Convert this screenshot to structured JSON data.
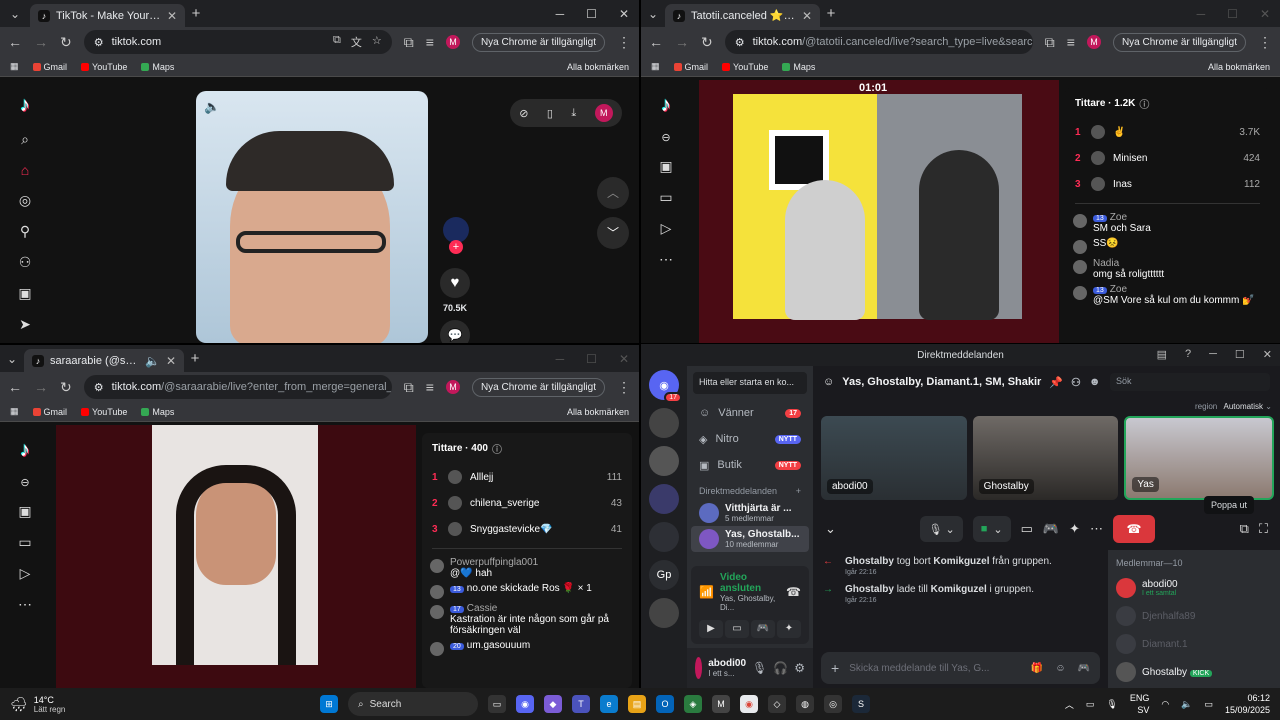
{
  "win1": {
    "tab_title": "TikTok - Make Your Day",
    "url": "tiktok.com",
    "update_label": "Nya Chrome är tillgängligt",
    "bookmarks": [
      "Gmail",
      "YouTube",
      "Maps"
    ],
    "all_bookmarks": "Alla bokmärken",
    "like_count": "70.5K",
    "profile_letter": "M"
  },
  "win2": {
    "tab_title": "Tatotii.canceled ⭐ (@tatotii.ca",
    "url_host": "tiktok.com",
    "url_path": "/@tatotii.canceled/live?search_type=live&search_id=2025...",
    "update_label": "Nya Chrome är tillgängligt",
    "bookmarks": [
      "Gmail",
      "YouTube",
      "Maps"
    ],
    "all_bookmarks": "Alla bokmärken",
    "timer": "01:01",
    "viewers_label": "Tittare · 1.2K",
    "ranking": [
      {
        "rank": "1",
        "name": "✌",
        "score": "3.7K"
      },
      {
        "rank": "2",
        "name": "Minisen",
        "score": "424"
      },
      {
        "rank": "3",
        "name": "Inas",
        "score": "112"
      }
    ],
    "chat": [
      {
        "user": "Zoe",
        "badge": "13",
        "text": "SM och Sara"
      },
      {
        "user": "",
        "badge": "",
        "text": "SS😣"
      },
      {
        "user": "Nadia",
        "badge": "",
        "text": "omg så roligtttttt"
      },
      {
        "user": "Zoe",
        "badge": "13",
        "text": "@SM Vore så kul om du kommm 💅"
      }
    ]
  },
  "win3": {
    "tab_title": "saraarabie (@saraarabie) ä",
    "url_host": "tiktok.com",
    "url_path": "/@saraarabie/live?enter_from_merge=general_search&en...",
    "update_label": "Nya Chrome är tillgängligt",
    "bookmarks": [
      "Gmail",
      "YouTube",
      "Maps"
    ],
    "all_bookmarks": "Alla bokmärken",
    "viewers_label": "Tittare · 400",
    "ranking": [
      {
        "rank": "1",
        "name": "Alllejj",
        "score": "111"
      },
      {
        "rank": "2",
        "name": "chilena_sverige",
        "score": "43"
      },
      {
        "rank": "3",
        "name": "Snyggastevicke💎",
        "score": "41"
      }
    ],
    "chat": [
      {
        "user": "Powerpuffpingla001",
        "badge": "",
        "text": "@💙 hah"
      },
      {
        "user": "",
        "badge": "13",
        "text": "no.one skickade Ros 🌹 × 1"
      },
      {
        "user": "Cassie",
        "badge": "17",
        "text": "Kastration är inte någon som går på försäkringen väl"
      },
      {
        "user": "",
        "badge": "20",
        "text": "um.gasouuum"
      }
    ]
  },
  "discord": {
    "title": "Direktmeddelanden",
    "search_dm": "Hitta eller starta en ko...",
    "nav": [
      {
        "label": "Vänner",
        "pill": "17"
      },
      {
        "label": "Nitro",
        "pill": "NYTT"
      },
      {
        "label": "Butik",
        "pill": "NYTT"
      }
    ],
    "dm_header": "Direktmeddelanden",
    "dms": [
      {
        "name": "Vitthjärta är ...",
        "sub": "5 medlemmar"
      },
      {
        "name": "Yas, Ghostalb...",
        "sub": "10 medlemmar"
      }
    ],
    "voice_title": "Video ansluten",
    "voice_sub": "Yas, Ghostalby, Di...",
    "user_name": "abodi00",
    "user_sub": "I ett s...",
    "guild_badge": "17",
    "guild_label": "Gp",
    "channel_title": "Yas, Ghostalby, Diamant.1, SM, Shakir",
    "search_placeholder": "Sök",
    "region_label": "region",
    "region_value": "Automatisk",
    "tiles": [
      {
        "name": "abodi00"
      },
      {
        "name": "Ghostalby"
      },
      {
        "name": "Yas"
      }
    ],
    "tooltip": "Poppa ut",
    "logs": [
      {
        "actor": "Ghostalby",
        "action": "tog bort",
        "target": "Komikguzel",
        "suffix": "från gruppen.",
        "time": "Igår 22:16"
      },
      {
        "actor": "Ghostalby",
        "action": "lade till",
        "target": "Komikguzel",
        "suffix": "i gruppen.",
        "time": "Igår 22:16"
      }
    ],
    "members_header": "Medlemmar—10",
    "members": [
      {
        "name": "abodi00",
        "status": "I ett samtal",
        "dim": false
      },
      {
        "name": "Djenhalfa89",
        "status": "",
        "dim": true
      },
      {
        "name": "Diamant.1",
        "status": "",
        "dim": true
      },
      {
        "name": "Ghostalby",
        "status": "KICK",
        "dim": false
      }
    ],
    "compose_placeholder": "Skicka meddelande till Yas, G..."
  },
  "taskbar": {
    "temp": "14°C",
    "weather": "Lätt regn",
    "search": "Search",
    "lang1": "ENG",
    "lang2": "SV",
    "time": "06:12",
    "date": "15/09/2025"
  }
}
